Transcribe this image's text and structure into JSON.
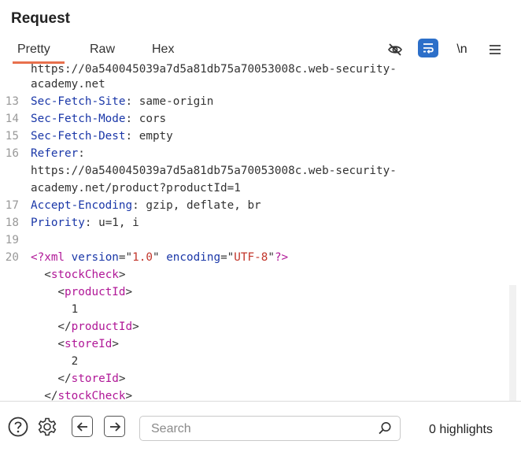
{
  "panel": {
    "title": "Request"
  },
  "tabs": [
    {
      "label": "Pretty",
      "active": true
    },
    {
      "label": "Raw",
      "active": false
    },
    {
      "label": "Hex",
      "active": false
    }
  ],
  "toolbar": {
    "hide_icon": "eye-slash-icon",
    "wrap_icon": "word-wrap-icon",
    "newline_label": "\\n",
    "menu_icon": "hamburger-icon",
    "accent_color": "#2c6fc9"
  },
  "editor": {
    "lines": [
      {
        "num": "",
        "segments": [
          {
            "text": "https://0a540045039a7d5a81db75a70053008c.web-security-",
            "cls": "p"
          }
        ]
      },
      {
        "num": "",
        "segments": [
          {
            "text": "academy.net",
            "cls": "p"
          }
        ]
      },
      {
        "num": "13",
        "segments": [
          {
            "text": "Sec-Fetch-Site",
            "cls": "k"
          },
          {
            "text": ": same-origin",
            "cls": "p"
          }
        ]
      },
      {
        "num": "14",
        "segments": [
          {
            "text": "Sec-Fetch-Mode",
            "cls": "k"
          },
          {
            "text": ": cors",
            "cls": "p"
          }
        ]
      },
      {
        "num": "15",
        "segments": [
          {
            "text": "Sec-Fetch-Dest",
            "cls": "k"
          },
          {
            "text": ": empty",
            "cls": "p"
          }
        ]
      },
      {
        "num": "16",
        "segments": [
          {
            "text": "Referer",
            "cls": "k"
          },
          {
            "text": ":",
            "cls": "p"
          }
        ]
      },
      {
        "num": "",
        "segments": [
          {
            "text": "https://0a540045039a7d5a81db75a70053008c.web-security-",
            "cls": "p"
          }
        ]
      },
      {
        "num": "",
        "segments": [
          {
            "text": "academy.net/product?productId=1",
            "cls": "p"
          }
        ]
      },
      {
        "num": "17",
        "segments": [
          {
            "text": "Accept-Encoding",
            "cls": "k"
          },
          {
            "text": ": gzip, deflate, br",
            "cls": "p"
          }
        ]
      },
      {
        "num": "18",
        "segments": [
          {
            "text": "Priority",
            "cls": "k"
          },
          {
            "text": ": u=1, i",
            "cls": "p"
          }
        ]
      },
      {
        "num": "19",
        "segments": []
      },
      {
        "num": "20",
        "segments": [
          {
            "text": "<?xml ",
            "cls": "t"
          },
          {
            "text": "version",
            "cls": "k"
          },
          {
            "text": "=\"",
            "cls": "p"
          },
          {
            "text": "1.0",
            "cls": "v"
          },
          {
            "text": "\" ",
            "cls": "p"
          },
          {
            "text": "encoding",
            "cls": "k"
          },
          {
            "text": "=\"",
            "cls": "p"
          },
          {
            "text": "UTF-8",
            "cls": "v"
          },
          {
            "text": "\"",
            "cls": "p"
          },
          {
            "text": "?>",
            "cls": "t"
          }
        ]
      },
      {
        "num": "",
        "segments": [
          {
            "text": "  <",
            "cls": "p"
          },
          {
            "text": "stockCheck",
            "cls": "t"
          },
          {
            "text": ">",
            "cls": "p"
          }
        ]
      },
      {
        "num": "",
        "segments": [
          {
            "text": "    <",
            "cls": "p"
          },
          {
            "text": "productId",
            "cls": "t"
          },
          {
            "text": ">",
            "cls": "p"
          }
        ]
      },
      {
        "num": "",
        "segments": [
          {
            "text": "      1",
            "cls": "p"
          }
        ]
      },
      {
        "num": "",
        "segments": [
          {
            "text": "    </",
            "cls": "p"
          },
          {
            "text": "productId",
            "cls": "t"
          },
          {
            "text": ">",
            "cls": "p"
          }
        ]
      },
      {
        "num": "",
        "segments": [
          {
            "text": "    <",
            "cls": "p"
          },
          {
            "text": "storeId",
            "cls": "t"
          },
          {
            "text": ">",
            "cls": "p"
          }
        ]
      },
      {
        "num": "",
        "segments": [
          {
            "text": "      2",
            "cls": "p"
          }
        ]
      },
      {
        "num": "",
        "segments": [
          {
            "text": "    </",
            "cls": "p"
          },
          {
            "text": "storeId",
            "cls": "t"
          },
          {
            "text": ">",
            "cls": "p"
          }
        ]
      },
      {
        "num": "",
        "segments": [
          {
            "text": "  </",
            "cls": "p"
          },
          {
            "text": "stockCheck",
            "cls": "t"
          },
          {
            "text": ">",
            "cls": "p"
          }
        ]
      }
    ]
  },
  "bottom_bar": {
    "help_icon": "help-circle-icon",
    "settings_icon": "gear-icon",
    "prev_icon": "arrow-left-icon",
    "next_icon": "arrow-right-icon",
    "search_placeholder": "Search",
    "search_value": "",
    "search_icon": "search-icon",
    "highlights": "0 highlights"
  }
}
